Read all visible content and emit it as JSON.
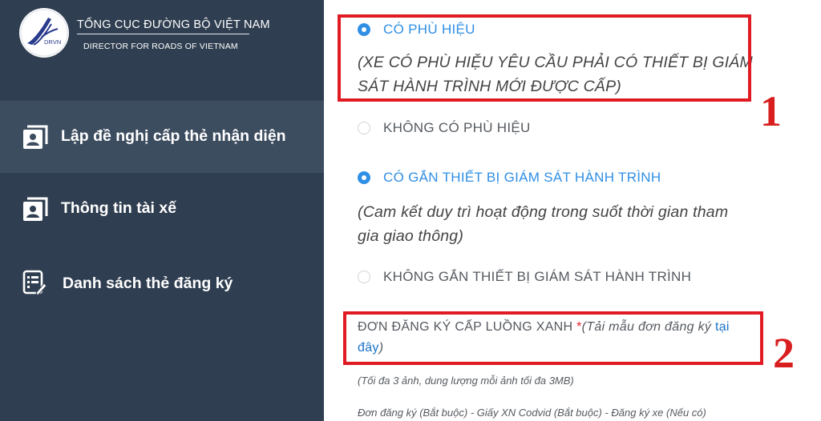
{
  "brand": {
    "logo_text": "DRVN",
    "title": "TỔNG CỤC ĐƯỜNG BỘ VIỆT NAM",
    "subtitle": "DIRECTOR FOR ROADS OF VIETNAM"
  },
  "sidebar": {
    "items": [
      {
        "label": "Lập đề nghị cấp thẻ nhận diện",
        "icon": "id-card-icon",
        "active": true
      },
      {
        "label": "Thông tin tài xế",
        "icon": "id-card-icon",
        "active": false
      },
      {
        "label": "Danh sách thẻ đăng ký",
        "icon": "list-edit-icon",
        "active": false
      }
    ]
  },
  "form": {
    "badge_group": {
      "option_yes": {
        "label": "CÓ PHÙ HIỆU",
        "selected": true
      },
      "note": "(XE CÓ PHÙ HIỆU YÊU CẦU PHẢI CÓ THIẾT BỊ GIÁM SÁT HÀNH TRÌNH MỚI ĐƯỢC CẤP)",
      "option_no": {
        "label": "KHÔNG CÓ PHÙ HIỆU",
        "selected": false
      }
    },
    "tracker_group": {
      "option_yes": {
        "label": "CÓ GẮN THIẾT BỊ GIÁM SÁT HÀNH TRÌNH",
        "selected": true
      },
      "note": "(Cam kết duy trì hoạt động trong suốt thời gian tham gia giao thông)",
      "option_no": {
        "label": "KHÔNG GẮN THIẾT BỊ GIÁM SÁT HÀNH TRÌNH",
        "selected": false
      }
    },
    "upload": {
      "label": "ĐƠN ĐĂNG KÝ CẤP LUỒNG XANH",
      "required_mark": "*",
      "hint_prefix": "(Tải mẫu đơn đăng ký ",
      "link_text": "tại đây",
      "hint_suffix": ")",
      "limit_note": "(Tối đa 3 ảnh, dung lượng mỗi ảnh tối đa 3MB)",
      "docs_note": "Đơn đăng ký (Bắt buộc) - Giấy XN Codvid (Bắt buộc) - Đăng ký xe (Nếu có)"
    }
  },
  "annotations": [
    "1",
    "2"
  ],
  "colors": {
    "sidebar_bg": "#2f3e50",
    "sidebar_active": "#3d4d60",
    "accent_blue": "#2f8fe5",
    "annotation_red": "#e01b24"
  }
}
